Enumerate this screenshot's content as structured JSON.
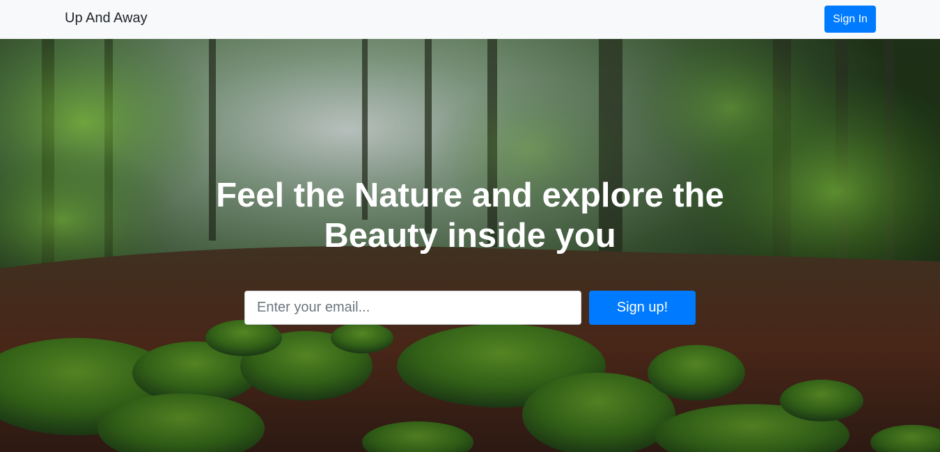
{
  "navbar": {
    "brand": "Up And Away",
    "signin_label": "Sign In"
  },
  "hero": {
    "title": "Feel the Nature and explore the Beauty inside you",
    "email_placeholder": "Enter your email...",
    "signup_label": "Sign up!",
    "background": "forest-photo"
  },
  "colors": {
    "primary": "#007bff",
    "navbar_bg": "#f8f9fa",
    "hero_text": "#ffffff"
  }
}
